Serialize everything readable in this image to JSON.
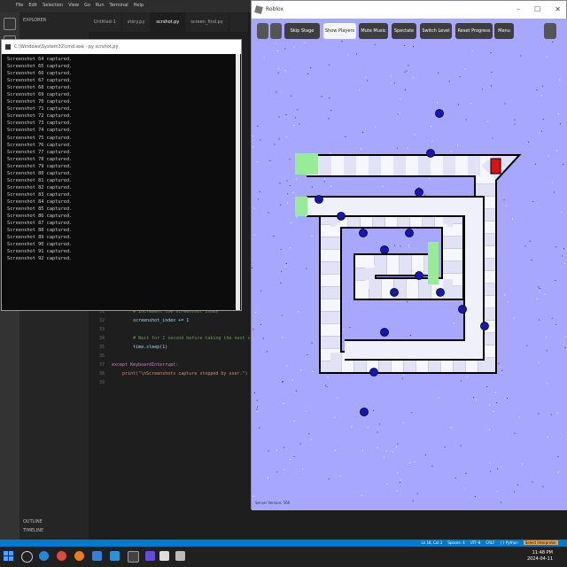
{
  "vscode": {
    "menu": [
      "File",
      "Edit",
      "Selection",
      "View",
      "Go",
      "Run",
      "Terminal",
      "Help"
    ],
    "explorer_header": "EXPLORER",
    "tabs": [
      "Untitled-1",
      "story.py",
      "scrshot.py",
      "screen_find.py"
    ],
    "outline": "OUTLINE",
    "timeline": "TIMELINE",
    "code": [
      {
        "ln": "31",
        "text": "        # Increment the screenshot index"
      },
      {
        "ln": "32",
        "text": "        screenshot_index += 1"
      },
      {
        "ln": "33",
        "text": ""
      },
      {
        "ln": "34",
        "text": "        # Wait for 1 second before taking the next screenshot"
      },
      {
        "ln": "35",
        "text": "        time.sleep(1)"
      },
      {
        "ln": "36",
        "text": ""
      },
      {
        "ln": "37",
        "text": "except KeyboardInterrupt:"
      },
      {
        "ln": "38",
        "text": "    print(\"\\nScreenshots capture stopped by user.\")"
      },
      {
        "ln": "39",
        "text": ""
      }
    ]
  },
  "terminal": {
    "title": "C:\\Windows\\System32\\cmd.exe - py  scrshot.py",
    "lines": [
      "Screenshot 64 captured.",
      "Screenshot 65 captured.",
      "Screenshot 66 captured.",
      "Screenshot 67 captured.",
      "Screenshot 68 captured.",
      "Screenshot 69 captured.",
      "Screenshot 70 captured.",
      "Screenshot 71 captured.",
      "Screenshot 72 captured.",
      "Screenshot 73 captured.",
      "Screenshot 74 captured.",
      "Screenshot 75 captured.",
      "Screenshot 76 captured.",
      "Screenshot 77 captured.",
      "Screenshot 78 captured.",
      "Screenshot 79 captured.",
      "Screenshot 80 captured.",
      "Screenshot 81 captured.",
      "Screenshot 82 captured.",
      "Screenshot 83 captured.",
      "Screenshot 84 captured.",
      "Screenshot 85 captured.",
      "Screenshot 86 captured.",
      "Screenshot 87 captured.",
      "Screenshot 88 captured.",
      "Screenshot 89 captured.",
      "Screenshot 90 captured.",
      "Screenshot 91 captured.",
      "Screenshot 92 captured."
    ]
  },
  "statusbar": {
    "items": [
      "Ln 18, Col 3",
      "Spaces: 4",
      "UTF-8",
      "CRLF",
      "{} Python"
    ],
    "notice": "Select Interpreter"
  },
  "taskbar": {
    "time": "11:48 PM",
    "date": "2024-04-11"
  },
  "roblox": {
    "title": "Roblox",
    "buttons": [
      "Skip Stage",
      "Show Players",
      "Mute Music",
      "Spectate",
      "Switch Level",
      "Reset Progress",
      "Menu"
    ],
    "footer": "Server Version: 566",
    "colors": {
      "background": "#a7a7ff",
      "path_light": "#ffffff",
      "path_alt": "#e2e2f6",
      "path_border": "#000000",
      "checkpoint": "#98ec98",
      "goal": "#dd1111",
      "player": "#1616b8"
    }
  }
}
